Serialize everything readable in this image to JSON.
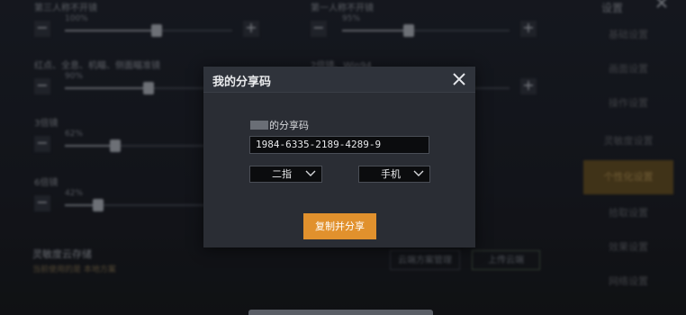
{
  "background": {
    "settings_title": "设置",
    "left_rows": [
      {
        "label": "第三人称不开镜",
        "value": "100%",
        "fill": 0.55
      },
      {
        "label": "红点、全息、机瞄、侧面瞄准镜",
        "value": "90%",
        "fill": 0.5
      },
      {
        "label": "3倍镜",
        "value": "62%",
        "fill": 0.3
      },
      {
        "label": "6倍镜",
        "value": "42%",
        "fill": 0.2
      }
    ],
    "right_rows": [
      {
        "label": "第一人称不开镜",
        "value": "95%",
        "fill": 0.4
      },
      {
        "label": "2倍镜、Win94",
        "value": "",
        "fill": 0.0
      }
    ],
    "sidebar_items": [
      "基础设置",
      "画面设置",
      "操作设置",
      "灵敏度设置",
      "个性化设置",
      "拾取设置",
      "效果设置",
      "网络设置"
    ],
    "active_sidebar_index": 3,
    "cloud_save_title": "灵敏度云存储",
    "cloud_save_subtitle": "当前使用的是 本地方案",
    "cloud_manage_button": "云端方案管理",
    "upload_button": "上传云端"
  },
  "dialog": {
    "title": "我的分享码",
    "share_label_suffix": "的分享码",
    "share_code": "1984-6335-2189-4289-9",
    "finger_select": "二指",
    "device_select": "手机",
    "copy_button": "复制并分享"
  },
  "colors": {
    "accent": "#e1912d",
    "dialog_bg": "#2a2d34",
    "field_bg": "#0b0c0e"
  }
}
